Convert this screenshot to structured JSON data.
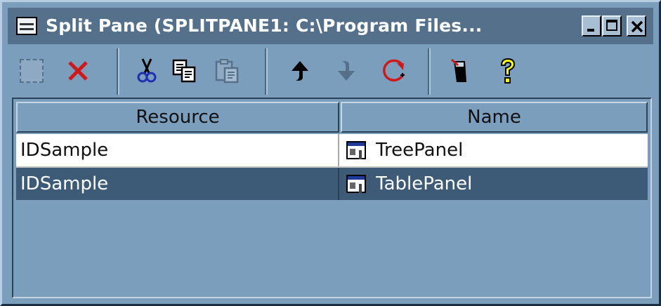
{
  "window": {
    "title": "Split Pane (SPLITPANE1: C:\\Program Files...",
    "minimize_icon": "minimize-icon",
    "maximize_icon": "maximize-icon",
    "close_icon": "close-icon"
  },
  "toolbar": {
    "items": [
      {
        "icon": "new-item-placeholder-icon",
        "enabled": false
      },
      {
        "icon": "delete-icon",
        "enabled": true,
        "color": "#d01818"
      },
      {
        "icon": "cut-icon",
        "enabled": true
      },
      {
        "icon": "copy-icon",
        "enabled": true
      },
      {
        "icon": "paste-icon",
        "enabled": false
      },
      {
        "icon": "move-up-icon",
        "enabled": true
      },
      {
        "icon": "move-down-icon",
        "enabled": false
      },
      {
        "icon": "refresh-icon",
        "enabled": true,
        "color": "#d01818"
      },
      {
        "icon": "properties-icon",
        "enabled": true
      },
      {
        "icon": "help-icon",
        "enabled": true,
        "color": "#ffff00"
      }
    ]
  },
  "table": {
    "columns": [
      "Resource",
      "Name"
    ],
    "rows": [
      {
        "resource": "IDSample",
        "name": "TreePanel",
        "selected": false
      },
      {
        "resource": "IDSample",
        "name": "TablePanel",
        "selected": true
      }
    ]
  },
  "colors": {
    "background": "#7b9ebd",
    "title_bar": "#54708a",
    "selected_row": "#3d5a76",
    "row": "#ffffff"
  }
}
